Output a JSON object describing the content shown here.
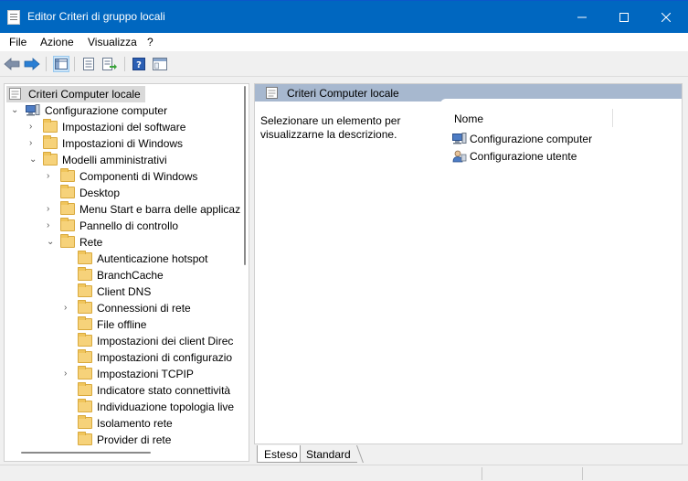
{
  "window": {
    "title": "Editor Criteri di gruppo locali",
    "controls": {
      "minimize": "—",
      "maximize": "☐",
      "close": "✕"
    }
  },
  "menu": {
    "file": "File",
    "azione": "Azione",
    "visualizza": "Visualizza",
    "help": "?"
  },
  "toolbar": {
    "icons": [
      "back-icon",
      "forward-icon",
      "show-hide-tree-icon",
      "properties-icon",
      "export-list-icon",
      "help-icon",
      "view-icon"
    ]
  },
  "tree": {
    "root": "Criteri Computer locale",
    "items": [
      {
        "label": "Configurazione computer"
      },
      {
        "label": "Impostazioni del software"
      },
      {
        "label": "Impostazioni di Windows"
      },
      {
        "label": "Modelli amministrativi"
      },
      {
        "label": "Componenti di Windows"
      },
      {
        "label": "Desktop"
      },
      {
        "label": "Menu Start e barra delle applicaz"
      },
      {
        "label": "Pannello di controllo"
      },
      {
        "label": "Rete"
      },
      {
        "label": "Autenticazione hotspot"
      },
      {
        "label": "BranchCache"
      },
      {
        "label": "Client DNS"
      },
      {
        "label": "Connessioni di rete"
      },
      {
        "label": "File offline"
      },
      {
        "label": "Impostazioni dei client Direc"
      },
      {
        "label": "Impostazioni di configurazio"
      },
      {
        "label": "Impostazioni TCPIP"
      },
      {
        "label": "Indicatore stato connettività"
      },
      {
        "label": "Individuazione topologia live"
      },
      {
        "label": "Isolamento rete"
      },
      {
        "label": "Provider di rete"
      }
    ]
  },
  "details": {
    "header": "Criteri Computer locale",
    "description": "Selezionare un elemento per visualizzarne la descrizione.",
    "column_name": "Nome",
    "rows": [
      "Configurazione computer",
      "Configurazione utente"
    ]
  },
  "tabs": {
    "extended": "Esteso",
    "standard": "Standard"
  },
  "colors": {
    "titlebar": "#0067c0",
    "header_band": "#a7b8cf",
    "folder": "#f6d27a"
  }
}
